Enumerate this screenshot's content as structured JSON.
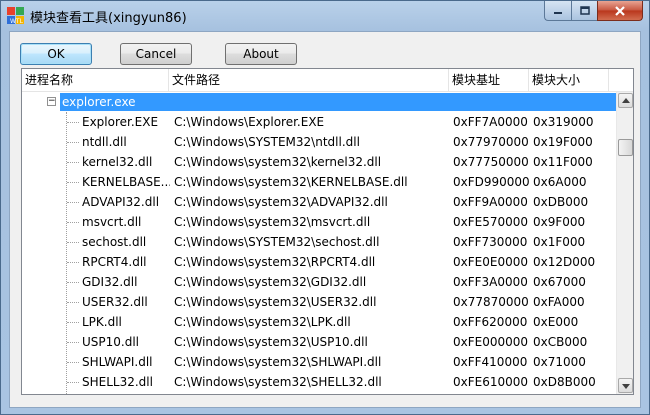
{
  "window": {
    "title": "模块查看工具(xingyun86)"
  },
  "buttons": {
    "ok": "OK",
    "cancel": "Cancel",
    "about": "About"
  },
  "list": {
    "columns": [
      "进程名称",
      "文件路径",
      "模块基址",
      "模块大小"
    ],
    "process": {
      "name": "explorer.exe",
      "expanded": true,
      "selected": true
    },
    "modules": [
      {
        "name": "Explorer.EXE",
        "path": "C:\\Windows\\Explorer.EXE",
        "base": "0xFF7A0000",
        "size": "0x319000"
      },
      {
        "name": "ntdll.dll",
        "path": "C:\\Windows\\SYSTEM32\\ntdll.dll",
        "base": "0x77970000",
        "size": "0x19F000"
      },
      {
        "name": "kernel32.dll",
        "path": "C:\\Windows\\system32\\kernel32.dll",
        "base": "0x77750000",
        "size": "0x11F000"
      },
      {
        "name": "KERNELBASE....",
        "path": "C:\\Windows\\system32\\KERNELBASE.dll",
        "base": "0xFD990000",
        "size": "0x6A000"
      },
      {
        "name": "ADVAPI32.dll",
        "path": "C:\\Windows\\system32\\ADVAPI32.dll",
        "base": "0xFF9A0000",
        "size": "0xDB000"
      },
      {
        "name": "msvcrt.dll",
        "path": "C:\\Windows\\system32\\msvcrt.dll",
        "base": "0xFE570000",
        "size": "0x9F000"
      },
      {
        "name": "sechost.dll",
        "path": "C:\\Windows\\SYSTEM32\\sechost.dll",
        "base": "0xFF730000",
        "size": "0x1F000"
      },
      {
        "name": "RPCRT4.dll",
        "path": "C:\\Windows\\system32\\RPCRT4.dll",
        "base": "0xFE0E0000",
        "size": "0x12D000"
      },
      {
        "name": "GDI32.dll",
        "path": "C:\\Windows\\system32\\GDI32.dll",
        "base": "0xFF3A0000",
        "size": "0x67000"
      },
      {
        "name": "USER32.dll",
        "path": "C:\\Windows\\system32\\USER32.dll",
        "base": "0x77870000",
        "size": "0xFA000"
      },
      {
        "name": "LPK.dll",
        "path": "C:\\Windows\\system32\\LPK.dll",
        "base": "0xFF620000",
        "size": "0xE000"
      },
      {
        "name": "USP10.dll",
        "path": "C:\\Windows\\system32\\USP10.dll",
        "base": "0xFE000000",
        "size": "0xCB000"
      },
      {
        "name": "SHLWAPI.dll",
        "path": "C:\\Windows\\system32\\SHLWAPI.dll",
        "base": "0xFF410000",
        "size": "0x71000"
      },
      {
        "name": "SHELL32.dll",
        "path": "C:\\Windows\\system32\\SHELL32.dll",
        "base": "0xFE610000",
        "size": "0xD8B000"
      }
    ]
  },
  "colors": {
    "selection": "#3399ff",
    "close_button": "#c7553e"
  }
}
